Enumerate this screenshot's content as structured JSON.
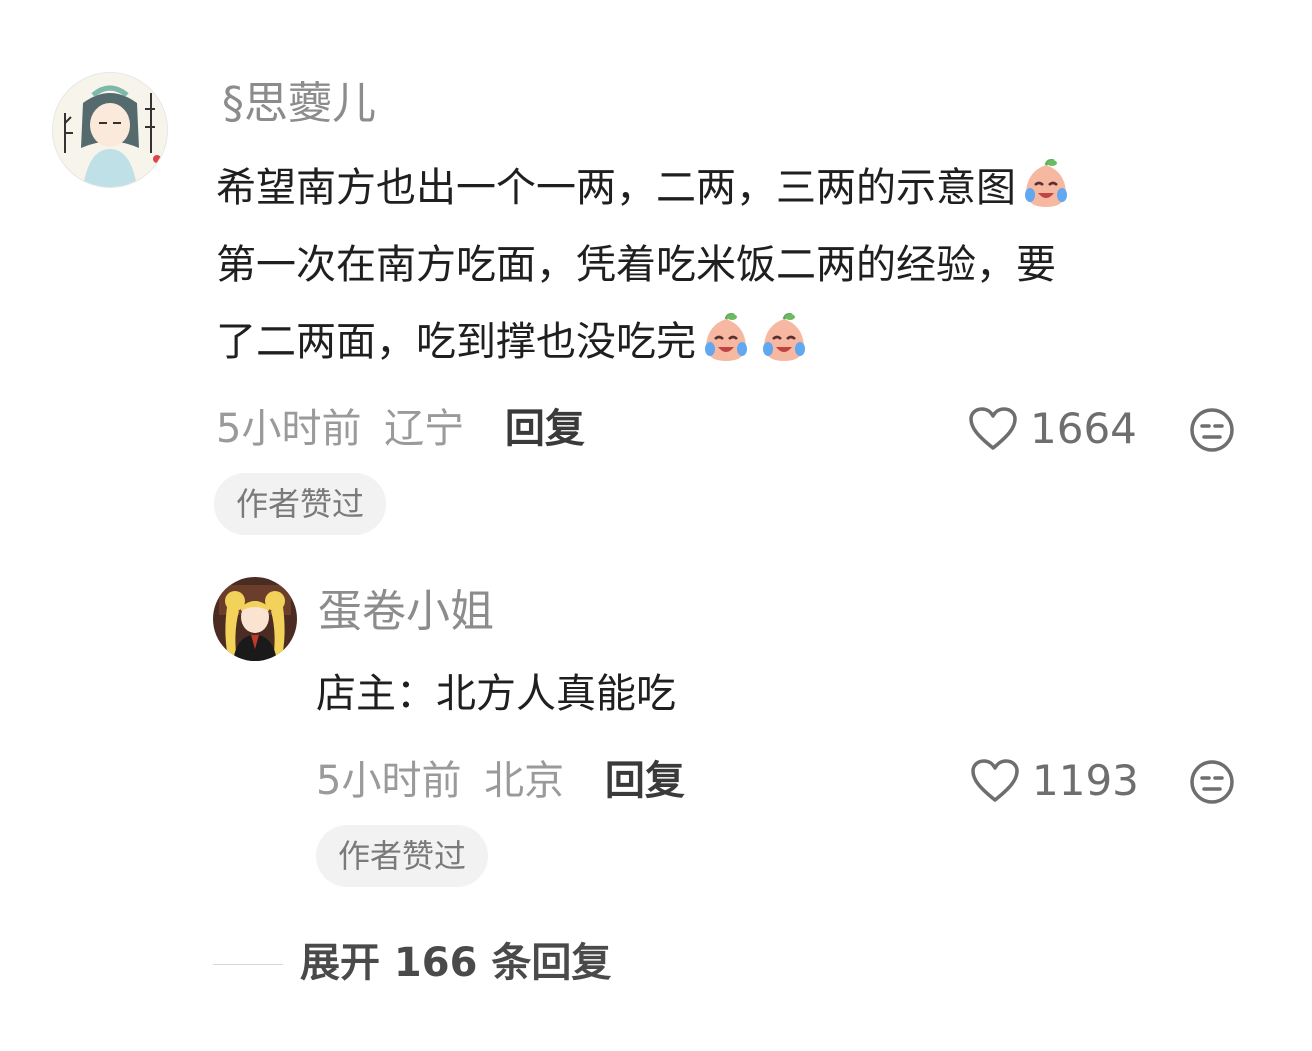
{
  "comment": {
    "username": "§思蘷儿",
    "lines": [
      "希望南方也出一个一两，二两，三两的示意图",
      "第一次在南方吃面，凭着吃米饭二两的经验，要",
      "了二两面，吃到撑也没吃完"
    ],
    "time": "5小时前",
    "location": "辽宁",
    "reply_label": "回复",
    "likes": "1664",
    "badge": "作者赞过",
    "emoji_name": "crying-laughing-peach-emoji"
  },
  "reply": {
    "username": "蛋卷小姐",
    "text": "店主：北方人真能吃",
    "time": "5小时前",
    "location": "北京",
    "reply_label": "回复",
    "likes": "1193",
    "badge": "作者赞过"
  },
  "expand_label": "展开 166 条回复",
  "colors": {
    "username": "#8c8c8c",
    "text": "#1f1f1f",
    "meta": "#9a9a9a",
    "badge_bg": "#f2f2f2"
  }
}
